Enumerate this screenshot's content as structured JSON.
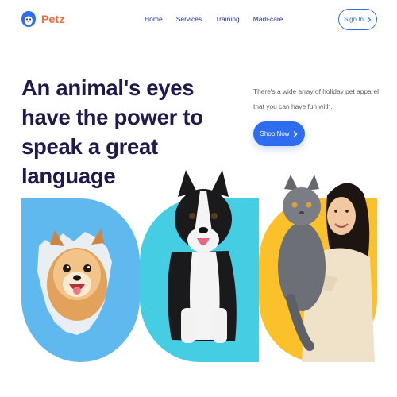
{
  "brand": {
    "name": "Petz",
    "accent": "#f26a3a",
    "mark_color": "#2e6cf0"
  },
  "nav": {
    "items": [
      {
        "label": "Home"
      },
      {
        "label": "Services"
      },
      {
        "label": "Training"
      },
      {
        "label": "Madi-care"
      }
    ],
    "color": "#2230a0"
  },
  "header": {
    "signin_label": "Sign In",
    "signin_icon": "chevron-right-icon"
  },
  "hero": {
    "title": "An animal's eyes have the power to speak a great language",
    "subtitle": "There's a wide array of holiday pet apparel that you can have fun with.",
    "cta_label": "Shop Now",
    "cta_icon": "chevron-right-icon",
    "cta_color": "#2e6cf0"
  },
  "gallery": {
    "cards": [
      {
        "subject": "pomeranian-dog",
        "bg": "#5fb9ee"
      },
      {
        "subject": "border-collie-dog",
        "bg": "#45cde4"
      },
      {
        "subject": "woman-holding-cat",
        "bg": "#fbc12a"
      }
    ]
  }
}
